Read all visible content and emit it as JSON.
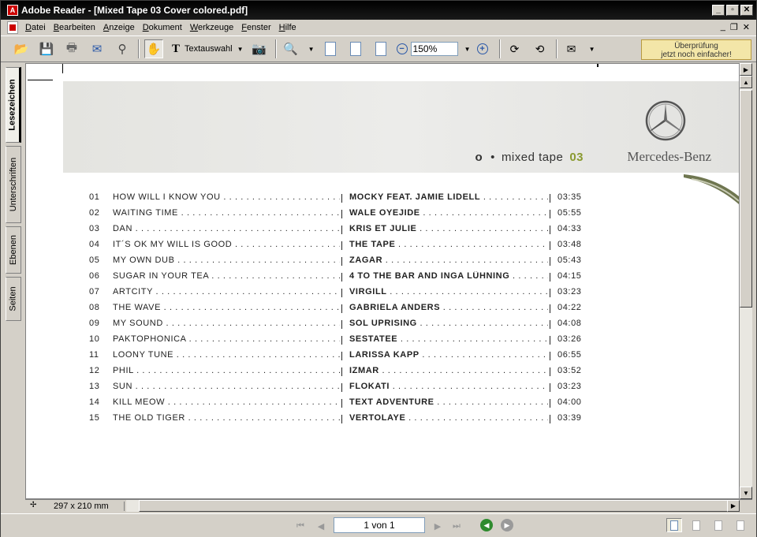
{
  "window": {
    "app_icon": "pdf-icon",
    "title": "Adobe Reader - [Mixed Tape 03 Cover colored.pdf]"
  },
  "menu": {
    "items": [
      "Datei",
      "Bearbeiten",
      "Anzeige",
      "Dokument",
      "Werkzeuge",
      "Fenster",
      "Hilfe"
    ]
  },
  "toolbar": {
    "text_select_label": "Textauswahl",
    "zoom_value": "150%",
    "promo_line1": "Überprüfung",
    "promo_line2": "jetzt noch einfacher!"
  },
  "side_tabs": [
    "Lesezeichen",
    "Unterschriften",
    "Ebenen",
    "Seiten"
  ],
  "document": {
    "tape_symbol_o": "o",
    "tape_symbol_dot": "•",
    "tape_name": "mixed tape",
    "tape_number": "03",
    "brand": "Mercedes-Benz",
    "tracks": [
      {
        "no": "01",
        "title": "HOW WILL I KNOW YOU",
        "artist": "MOCKY FEAT. JAMIE LIDELL",
        "duration": "03:35"
      },
      {
        "no": "02",
        "title": "WAITING TIME",
        "artist": "WALE OYEJIDE",
        "duration": "05:55"
      },
      {
        "no": "03",
        "title": "DAN",
        "artist": "KRIS ET JULIE",
        "duration": "04:33"
      },
      {
        "no": "04",
        "title": "IT´S OK MY WILL IS GOOD",
        "artist": "THE TAPE",
        "duration": "03:48"
      },
      {
        "no": "05",
        "title": "MY OWN DUB",
        "artist": "ZAGAR",
        "duration": "05:43"
      },
      {
        "no": "06",
        "title": "SUGAR IN YOUR TEA",
        "artist": "4 TO THE BAR AND INGA LÜHNING",
        "duration": "04:15"
      },
      {
        "no": "07",
        "title": "ARTCITY",
        "artist": "VIRGILL",
        "duration": "03:23"
      },
      {
        "no": "08",
        "title": "THE WAVE",
        "artist": "GABRIELA ANDERS",
        "duration": "04:22"
      },
      {
        "no": "09",
        "title": "MY SOUND",
        "artist": "SOL UPRISING",
        "duration": "04:08"
      },
      {
        "no": "10",
        "title": "PAKTOPHONICA",
        "artist": "SESTATEE",
        "duration": "03:26"
      },
      {
        "no": "11",
        "title": "LOONY TUNE",
        "artist": "LARISSA KAPP",
        "duration": "06:55"
      },
      {
        "no": "12",
        "title": "PHIL",
        "artist": "IZMAR",
        "duration": "03:52"
      },
      {
        "no": "13",
        "title": "SUN",
        "artist": "FLOKATI",
        "duration": "03:23"
      },
      {
        "no": "14",
        "title": "KILL MEOW",
        "artist": "TEXT ADVENTURE",
        "duration": "04:00"
      },
      {
        "no": "15",
        "title": "THE OLD TIGER",
        "artist": "VERTOLAYE",
        "duration": "03:39"
      }
    ]
  },
  "status": {
    "page_size": "297 x 210 mm"
  },
  "navigation": {
    "page_indicator": "1 von 1"
  },
  "colors": {
    "accent_green": "#8a9a30",
    "banner_gray": "#e6e6e3",
    "promo_bg": "#f3e6a8"
  }
}
